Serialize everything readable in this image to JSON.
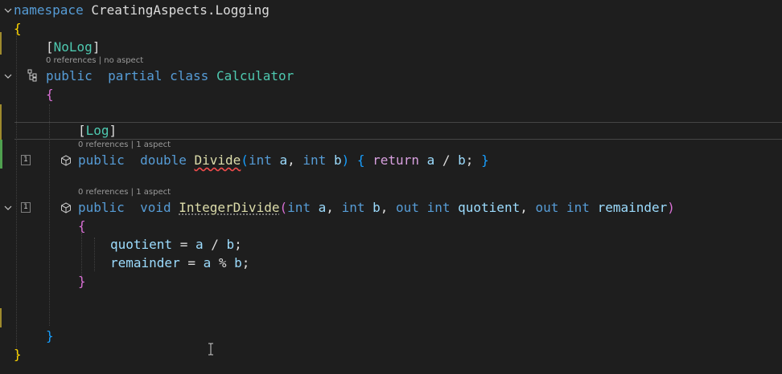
{
  "code": {
    "namespace_kw": "namespace",
    "namespace_name": "CreatingAspects.Logging",
    "open_brace_1": "{",
    "nolog_attr_open": "[",
    "nolog_attr_name": "NoLog",
    "nolog_attr_close": "]",
    "class_lens": "0 references | no aspect",
    "class_public": "public",
    "class_partial": "partial",
    "class_kw": "class",
    "class_name": "Calculator",
    "open_brace_2": "{",
    "log_attr_open": "[",
    "log_attr_name": "Log",
    "log_attr_close": "]",
    "divide_lens": "0 references | 1 aspect",
    "divide_public": "public",
    "divide_double": "double",
    "divide_name": "Divide",
    "divide_lparen": "(",
    "divide_int1": "int",
    "divide_a": "a",
    "divide_comma": ",",
    "divide_int2": "int",
    "divide_b": "b",
    "divide_rparen": ")",
    "divide_lbrace": "{",
    "divide_return": "return",
    "divide_expr_a": "a",
    "divide_slash": " / ",
    "divide_expr_b": "b",
    "divide_semi": ";",
    "divide_rbrace": "}",
    "intdiv_lens": "0 references | 1 aspect",
    "intdiv_public": "public",
    "intdiv_void": "void",
    "intdiv_name": "IntegerDivide",
    "intdiv_lparen": "(",
    "intdiv_int1": "int",
    "intdiv_a": "a",
    "intdiv_comma1": ",",
    "intdiv_int2": "int",
    "intdiv_b": "b",
    "intdiv_comma2": ",",
    "intdiv_out1": "out",
    "intdiv_int3": "int",
    "intdiv_quotient": "quotient",
    "intdiv_comma3": ",",
    "intdiv_out2": "out",
    "intdiv_int4": "int",
    "intdiv_remainder": "remainder",
    "intdiv_rparen": ")",
    "body_lbrace": "{",
    "stmt1_var": "quotient",
    "stmt1_op": " = ",
    "stmt1_a": "a",
    "stmt1_slash": " / ",
    "stmt1_b": "b",
    "stmt1_semi": ";",
    "stmt2_var": "remainder",
    "stmt2_op": " = ",
    "stmt2_a": "a",
    "stmt2_mod": " % ",
    "stmt2_b": "b",
    "stmt2_semi": ";",
    "body_rbrace": "}",
    "close_brace_2": "}",
    "close_brace_1": "}"
  },
  "margin": {
    "badge_divide": "1",
    "badge_intdiv": "1"
  },
  "icons": {
    "fold": "chevron-down-icon",
    "class_structure": "class-structure-icon",
    "aspect": "aspect-cube-icon",
    "cursor": "text-cursor-icon"
  },
  "colors": {
    "background": "#1e1e1e",
    "keyword": "#569cd6",
    "type": "#4ec9b0",
    "function": "#dcdcaa",
    "parameter": "#9cdcfe",
    "control": "#d8a0df",
    "bracket_gold": "#ffd700",
    "bracket_orchid": "#da70d6",
    "bracket_blue": "#179fff",
    "change_yellow": "#9e8a2d",
    "change_green": "#4fa04f",
    "error_squiggle": "#f14c4c"
  }
}
